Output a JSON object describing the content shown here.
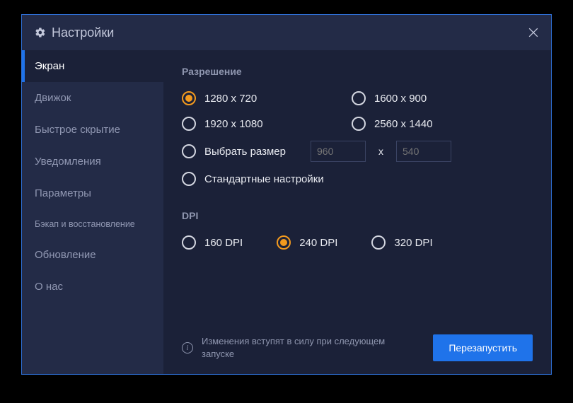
{
  "window": {
    "title": "Настройки"
  },
  "sidebar": {
    "items": [
      {
        "label": "Экран",
        "active": true
      },
      {
        "label": "Движок"
      },
      {
        "label": "Быстрое скрытие"
      },
      {
        "label": "Уведомления"
      },
      {
        "label": "Параметры"
      },
      {
        "label": "Бэкап и восстановление",
        "small": true
      },
      {
        "label": "Обновление"
      },
      {
        "label": "О нас"
      }
    ]
  },
  "content": {
    "resolution": {
      "title": "Разрешение",
      "options": [
        {
          "label": "1280 x 720",
          "selected": true
        },
        {
          "label": "1600 x 900"
        },
        {
          "label": "1920 x 1080"
        },
        {
          "label": "2560 x 1440"
        }
      ],
      "custom": {
        "label": "Выбрать размер",
        "width_placeholder": "960",
        "height_placeholder": "540",
        "separator": "x"
      },
      "default": {
        "label": "Стандартные настройки"
      }
    },
    "dpi": {
      "title": "DPI",
      "options": [
        {
          "label": "160 DPI"
        },
        {
          "label": "240 DPI",
          "selected": true
        },
        {
          "label": "320 DPI"
        }
      ]
    }
  },
  "footer": {
    "notice": "Изменения вступят в силу при следующем запуске",
    "restart_label": "Перезапустить"
  }
}
